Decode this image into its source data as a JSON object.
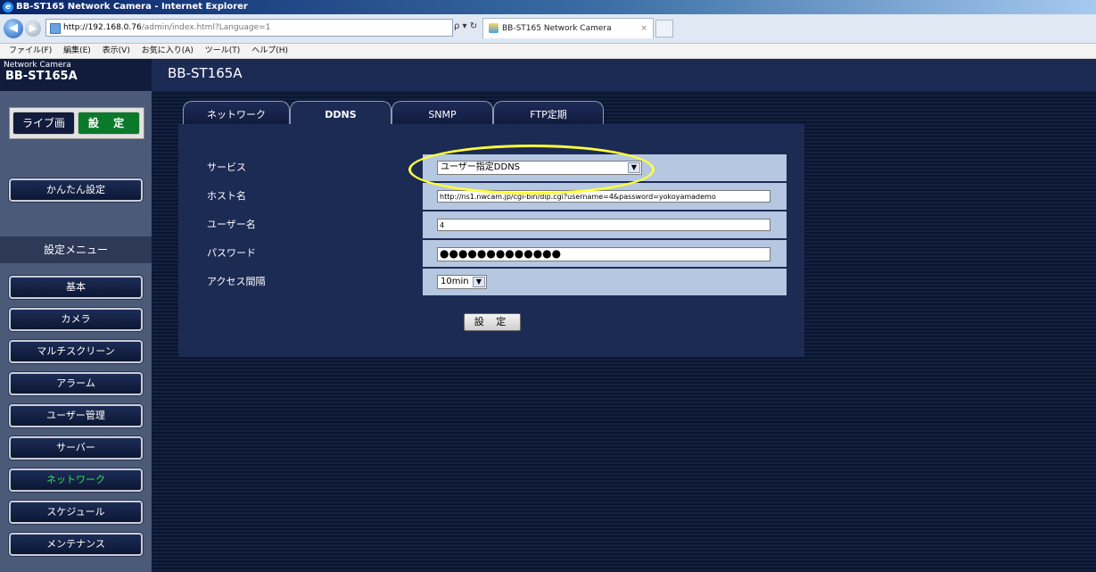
{
  "browser": {
    "window_title": "BB-ST165 Network Camera - Internet Explorer",
    "url_host": "http://192.168.0.76",
    "url_path": "/admin/index.html?Language=1",
    "search_glyph": "ρ ▾ ↻",
    "tab_title": "BB-ST165 Network Camera",
    "tab_close": "×",
    "menu": [
      "ファイル(F)",
      "編集(E)",
      "表示(V)",
      "お気に入り(A)",
      "ツール(T)",
      "ヘルプ(H)"
    ]
  },
  "header": {
    "brand_small": "Network Camera",
    "brand_model": "BB-ST165A",
    "title": "BB-ST165A"
  },
  "sidebar": {
    "live_label": "ライブ画",
    "setup_label": "設 定",
    "easy_setup": "かんたん設定",
    "menu_heading": "設定メニュー",
    "items": [
      "基本",
      "カメラ",
      "マルチスクリーン",
      "アラーム",
      "ユーザー管理",
      "サーバー",
      "ネットワーク",
      "スケジュール",
      "メンテナンス"
    ],
    "active_item": "ネットワーク"
  },
  "tabs": [
    "ネットワーク",
    "DDNS",
    "SNMP",
    "FTP定期"
  ],
  "active_tab": "DDNS",
  "form": {
    "service_label": "サービス",
    "service_value": "ユーザー指定DDNS",
    "host_label": "ホスト名",
    "host_value": "http://ns1.nwcam.jp/cgi-bin/dip.cgi?username=4&password=yokoyamademo",
    "user_label": "ユーザー名",
    "user_value": "4",
    "password_label": "パスワード",
    "password_value": "●●●●●●●●●●●●●",
    "interval_label": "アクセス間隔",
    "interval_value": "10min",
    "submit_label": "設 定"
  },
  "colors": {
    "annotation_circle": "#ffff3a",
    "active_green": "#2ee05a",
    "setup_green": "#0a7a2a"
  }
}
